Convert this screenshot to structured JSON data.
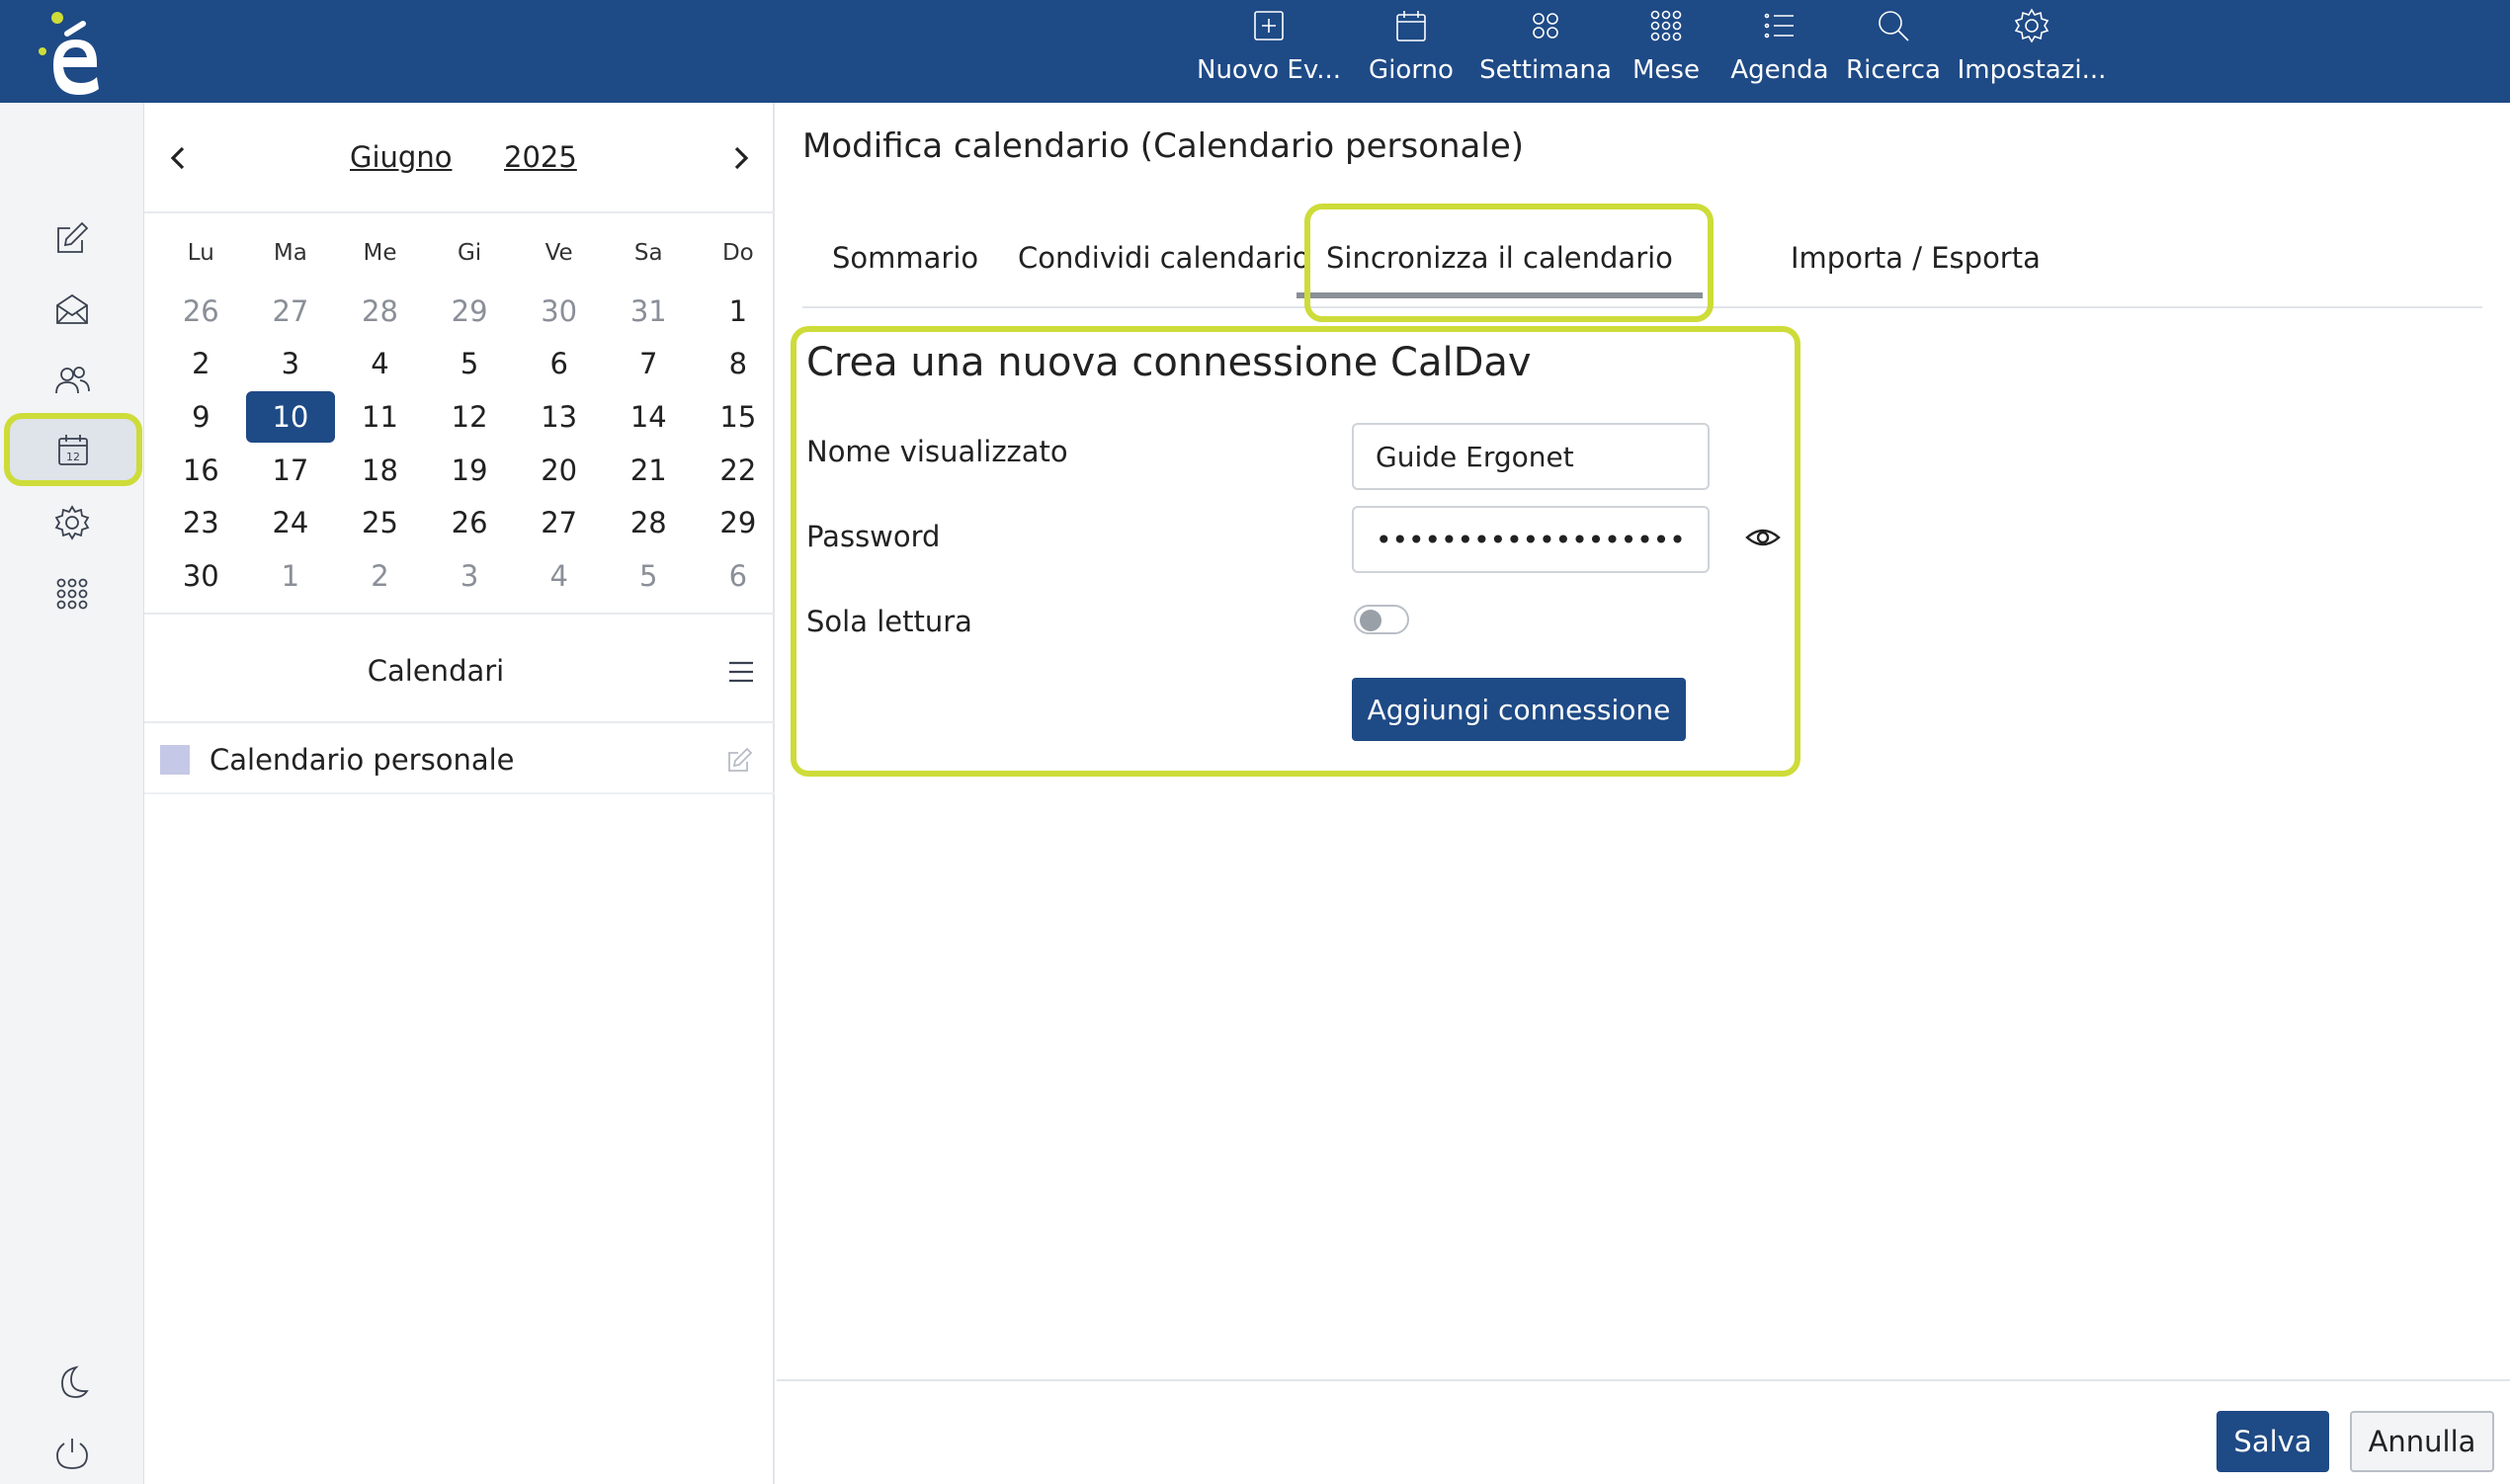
{
  "colors": {
    "brand": "#1e4a86",
    "highlight": "#cddc39",
    "swatch": "#c5c8e6"
  },
  "toolbar": [
    {
      "label": "Nuovo Ev...",
      "icon": "plus-square-icon"
    },
    {
      "label": "Giorno",
      "icon": "calendar-icon"
    },
    {
      "label": "Settimana",
      "icon": "grid-four-icon"
    },
    {
      "label": "Mese",
      "icon": "grid-nine-icon"
    },
    {
      "label": "Agenda",
      "icon": "list-icon"
    },
    {
      "label": "Ricerca",
      "icon": "search-icon"
    },
    {
      "label": "Impostazi...",
      "icon": "gear-icon"
    }
  ],
  "rail": [
    "compose-icon",
    "mail-icon",
    "contacts-icon",
    "calendar-icon",
    "settings-icon",
    "apps-icon",
    "moon-icon",
    "power-icon"
  ],
  "mini_calendar": {
    "month": "Giugno",
    "year": "2025",
    "weekdays": [
      "Lu",
      "Ma",
      "Me",
      "Gi",
      "Ve",
      "Sa",
      "Do"
    ],
    "weeks": [
      [
        "26",
        "27",
        "28",
        "29",
        "30",
        "31",
        "1"
      ],
      [
        "2",
        "3",
        "4",
        "5",
        "6",
        "7",
        "8"
      ],
      [
        "9",
        "10",
        "11",
        "12",
        "13",
        "14",
        "15"
      ],
      [
        "16",
        "17",
        "18",
        "19",
        "20",
        "21",
        "22"
      ],
      [
        "23",
        "24",
        "25",
        "26",
        "27",
        "28",
        "29"
      ],
      [
        "30",
        "1",
        "2",
        "3",
        "4",
        "5",
        "6"
      ]
    ],
    "today": "10"
  },
  "calendars": {
    "title": "Calendari",
    "items": [
      {
        "name": "Calendario personale"
      }
    ]
  },
  "main": {
    "title": "Modifica calendario (Calendario personale)",
    "tabs": [
      "Sommario",
      "Condividi calendario",
      "Sincronizza il calendario",
      "Importa / Esporta"
    ],
    "active_tab": "Sincronizza il calendario"
  },
  "form": {
    "title": "Crea una nuova connessione CalDav",
    "display_name_label": "Nome visualizzato",
    "display_name_value": "Guide Ergonet",
    "password_label": "Password",
    "password_value": "•••••••••••••••••••",
    "readonly_label": "Sola lettura",
    "readonly_on": false,
    "add_button": "Aggiungi connessione"
  },
  "footer": {
    "save": "Salva",
    "cancel": "Annulla"
  }
}
